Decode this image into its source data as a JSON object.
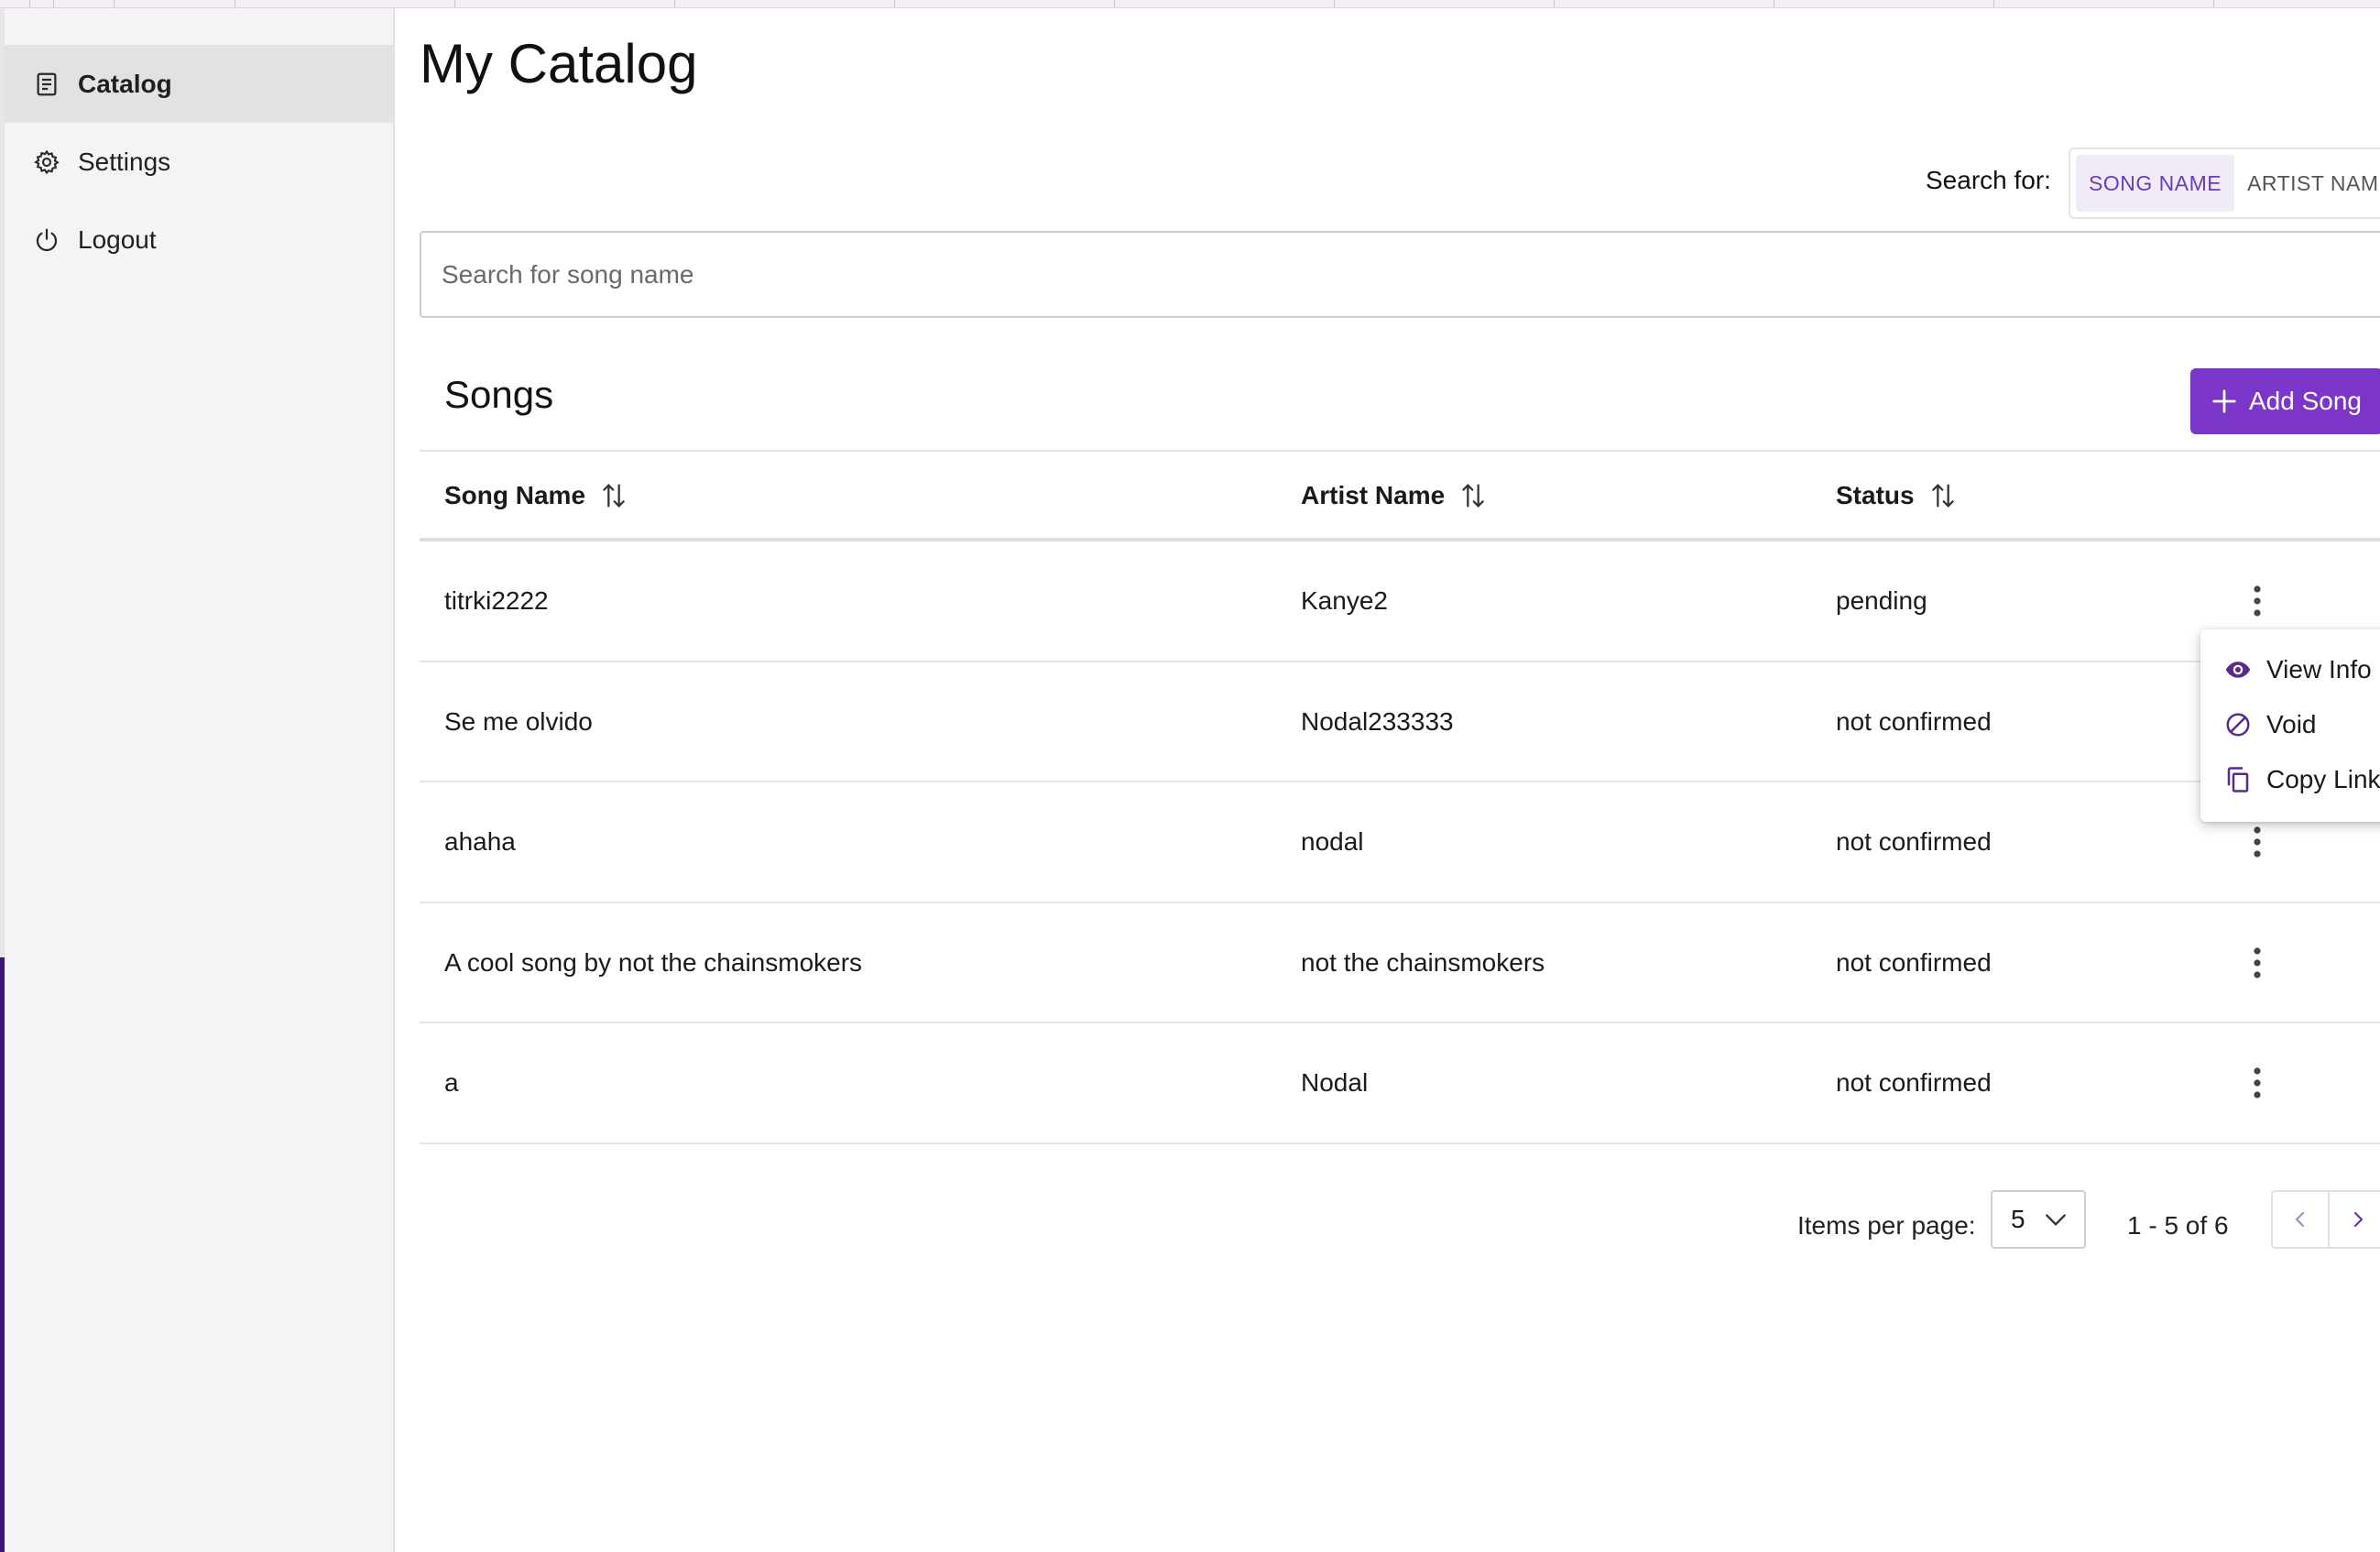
{
  "sidebar": {
    "items": [
      {
        "label": "Catalog",
        "icon": "catalog-icon",
        "active": true
      },
      {
        "label": "Settings",
        "icon": "gear-icon",
        "active": false
      },
      {
        "label": "Logout",
        "icon": "power-icon",
        "active": false
      }
    ]
  },
  "main": {
    "title": "My Catalog",
    "search_for_label": "Search for:",
    "search_modes": [
      "SONG NAME",
      "ARTIST NAME"
    ],
    "search_placeholder": "Search for song name",
    "section_title": "Songs",
    "add_button_label": "Add Song"
  },
  "table": {
    "columns": [
      "Song Name",
      "Artist Name",
      "Status"
    ],
    "rows": [
      {
        "song": "titrki2222",
        "artist": "Kanye2",
        "status": "pending"
      },
      {
        "song": "Se me olvido",
        "artist": "Nodal233333",
        "status": "not confirmed"
      },
      {
        "song": "ahaha",
        "artist": "nodal",
        "status": "not confirmed"
      },
      {
        "song": "A cool song by not the chainsmokers",
        "artist": "not the chainsmokers",
        "status": "not confirmed"
      },
      {
        "song": "a",
        "artist": "Nodal",
        "status": "not confirmed"
      }
    ]
  },
  "row_menu": {
    "items": [
      {
        "label": "View Info",
        "icon": "eye-icon"
      },
      {
        "label": "Void",
        "icon": "block-icon"
      },
      {
        "label": "Copy Link",
        "icon": "copy-icon"
      }
    ]
  },
  "pagination": {
    "items_per_page_label": "Items per page:",
    "items_per_page": "5",
    "range": "1 - 5 of 6"
  },
  "colors": {
    "accent": "#7b35c8",
    "accent_dark": "#5a2a8a",
    "sidebar_bg": "#f4f4f4",
    "sidebar_active": "#e2e2e2"
  }
}
